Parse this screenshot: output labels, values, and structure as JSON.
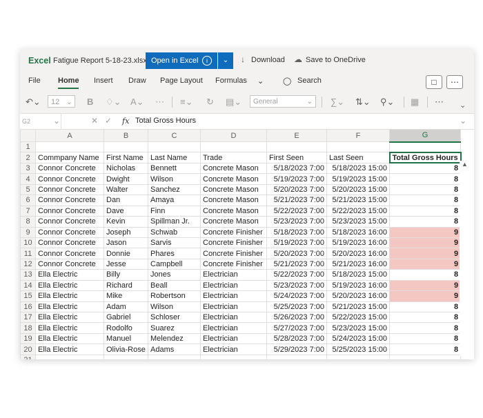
{
  "titlebar": {
    "app_name": "Excel",
    "file_name": "Fatigue Report 5-18-23.xlsx",
    "open_button": "Open in Excel",
    "download": "Download",
    "save_onedrive": "Save to OneDrive"
  },
  "ribbon": {
    "tabs": [
      "File",
      "Home",
      "Insert",
      "Draw",
      "Page Layout",
      "Formulas"
    ],
    "search": "Search"
  },
  "toolbar": {
    "font_size": "12",
    "number_format": "General"
  },
  "formula_bar": {
    "name_box": "G2",
    "fx": "fx",
    "content": "Total Gross Hours"
  },
  "sheet": {
    "columns": [
      "A",
      "B",
      "C",
      "D",
      "E",
      "F",
      "G"
    ],
    "header_row": [
      "Commpany Name",
      "First Name",
      "Last Name",
      "Trade",
      "First Seen",
      "Last Seen",
      "Total Gross Hours"
    ],
    "rows": [
      [
        "Connor Concrete",
        "Nicholas",
        "Bennett",
        "Concrete Mason",
        "5/18/2023 7:00",
        "5/18/2023 15:00",
        "8"
      ],
      [
        "Connor Concrete",
        "Dwight",
        "Wilson",
        "Concrete Mason",
        "5/19/2023 7:00",
        "5/19/2023 15:00",
        "8"
      ],
      [
        "Connor Concrete",
        "Walter",
        "Sanchez",
        "Concrete Mason",
        "5/20/2023 7:00",
        "5/20/2023 15:00",
        "8"
      ],
      [
        "Connor Concrete",
        "Dan",
        "Amaya",
        "Concrete Mason",
        "5/21/2023 7:00",
        "5/21/2023 15:00",
        "8"
      ],
      [
        "Connor Concrete",
        "Dave",
        "Finn",
        "Concrete Mason",
        "5/22/2023 7:00",
        "5/22/2023 15:00",
        "8"
      ],
      [
        "Connor Concrete",
        "Kevin",
        "Spillman Jr.",
        "Concrete Mason",
        "5/23/2023 7:00",
        "5/23/2023 15:00",
        "8"
      ],
      [
        "Connor Concrete",
        "Joseph",
        "Schwab",
        "Concrete Finisher",
        "5/18/2023 7:00",
        "5/18/2023 16:00",
        "9"
      ],
      [
        "Connor Concrete",
        "Jason",
        "Sarvis",
        "Concrete Finisher",
        "5/19/2023 7:00",
        "5/19/2023 16:00",
        "9"
      ],
      [
        "Connor Concrete",
        "Donnie",
        "Phares",
        "Concrete Finisher",
        "5/20/2023 7:00",
        "5/20/2023 16:00",
        "9"
      ],
      [
        "Connor Concrete",
        "Jesse",
        "Campbell",
        "Concrete Finisher",
        "5/21/2023 7:00",
        "5/21/2023 16:00",
        "9"
      ],
      [
        "Ella Electric",
        "Billy",
        "Jones",
        "Electrician",
        "5/22/2023 7:00",
        "5/18/2023 15:00",
        "8"
      ],
      [
        "Ella Electric",
        "Richard",
        "Beall",
        "Electrician",
        "5/23/2023 7:00",
        "5/19/2023 16:00",
        "9"
      ],
      [
        "Ella Electric",
        "Mike",
        "Robertson",
        "Electrician",
        "5/24/2023 7:00",
        "5/20/2023 16:00",
        "9"
      ],
      [
        "Ella Electric",
        "Adam",
        "Wilson",
        "Electrician",
        "5/25/2023 7:00",
        "5/21/2023 15:00",
        "8"
      ],
      [
        "Ella Electric",
        "Gabriel",
        "Schloser",
        "Electrician",
        "5/26/2023 7:00",
        "5/22/2023 15:00",
        "8"
      ],
      [
        "Ella Electric",
        "Rodolfo",
        "Suarez",
        "Electrician",
        "5/27/2023 7:00",
        "5/23/2023 15:00",
        "8"
      ],
      [
        "Ella Electric",
        "Manuel",
        "Melendez",
        "Electrician",
        "5/28/2023 7:00",
        "5/24/2023 15:00",
        "8"
      ],
      [
        "Ella Electric",
        "Olivia-Rose",
        "Adams",
        "Electrician",
        "5/29/2023 7:00",
        "5/25/2023 15:00",
        "8"
      ]
    ],
    "highlight_color": "#f4c7c3",
    "accent_color": "#217346"
  }
}
